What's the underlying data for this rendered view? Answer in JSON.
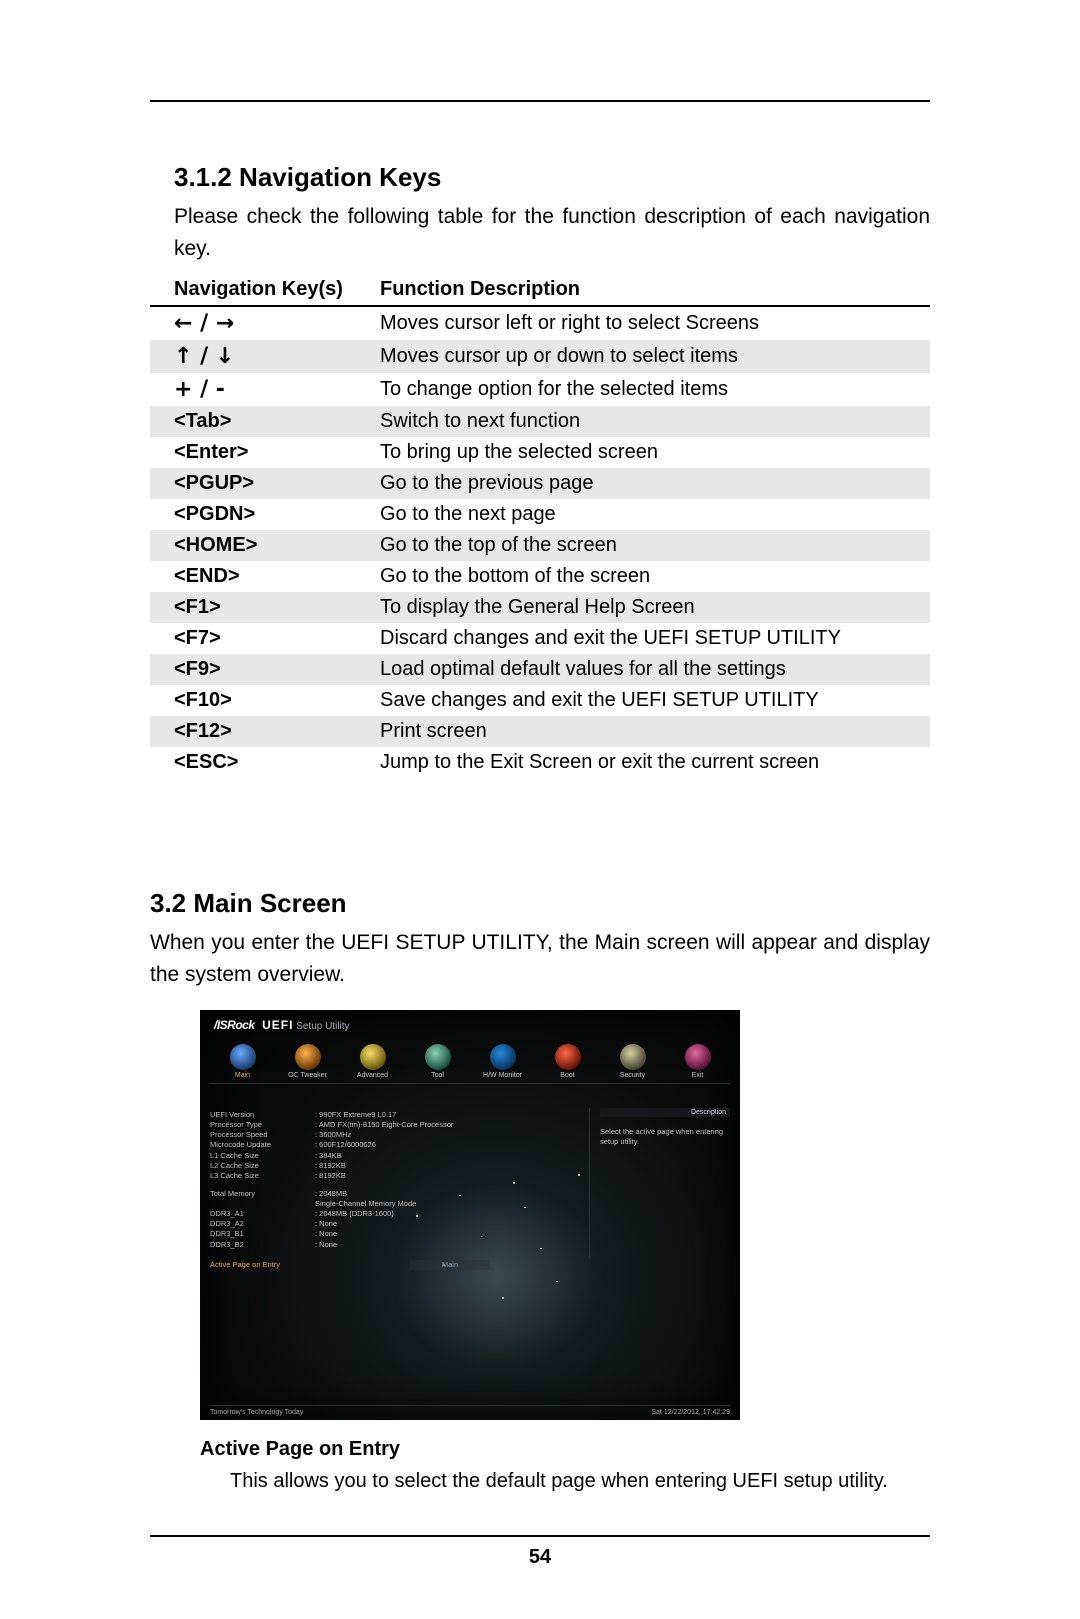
{
  "sections": {
    "nav_keys": {
      "title": "3.1.2  Navigation Keys",
      "intro": "Please check the following table for the function description of each navigation key."
    },
    "main_screen": {
      "title": "3.2  Main Screen",
      "intro": "When you enter the UEFI SETUP UTILITY, the Main screen will appear and display the system overview."
    }
  },
  "nav_table": {
    "headers": {
      "key": "Navigation Key(s)",
      "func": "Function Description"
    },
    "rows": [
      {
        "key_html": "← / →",
        "key_class": "arrow-cell",
        "func": "Moves cursor left or right to select Screens"
      },
      {
        "key_html": "↑ / ↓",
        "key_class": "arrow-cell",
        "func": "Moves cursor up or down to select items"
      },
      {
        "key_html": "+  /  -",
        "key_class": "arrow-cell",
        "func": "To change option for the selected items"
      },
      {
        "key_html": "<Tab>",
        "key_class": "",
        "func": "Switch to next function"
      },
      {
        "key_html": "<Enter>",
        "key_class": "",
        "func": "To bring up the selected screen"
      },
      {
        "key_html": "<PGUP>",
        "key_class": "",
        "func": "Go to the previous page"
      },
      {
        "key_html": "<PGDN>",
        "key_class": "",
        "func": "Go to the next page"
      },
      {
        "key_html": "<HOME>",
        "key_class": "",
        "func": "Go to the top of the screen"
      },
      {
        "key_html": "<END>",
        "key_class": "",
        "func": "Go to the bottom of the screen"
      },
      {
        "key_html": "<F1>",
        "key_class": "",
        "func": "To display the General Help Screen"
      },
      {
        "key_html": "<F7>",
        "key_class": "",
        "func": "Discard changes and exit the UEFI SETUP UTILITY"
      },
      {
        "key_html": "<F9>",
        "key_class": "",
        "func": "Load optimal default values for all the settings"
      },
      {
        "key_html": "<F10>",
        "key_class": "",
        "func": "Save changes and exit the UEFI SETUP UTILITY"
      },
      {
        "key_html": "<F12>",
        "key_class": "",
        "func": "Print screen"
      },
      {
        "key_html": "<ESC>",
        "key_class": "",
        "func": "Jump to the Exit Screen or exit the current screen"
      }
    ]
  },
  "bios": {
    "brand_styled": "/ISRock",
    "title_uefi": "UEFI",
    "title_setup": "Setup Utility",
    "tabs": [
      {
        "label": "Main",
        "icon": "ti-main",
        "active": true
      },
      {
        "label": "OC Tweaker",
        "icon": "ti-oc"
      },
      {
        "label": "Advanced",
        "icon": "ti-adv"
      },
      {
        "label": "Tool",
        "icon": "ti-tool"
      },
      {
        "label": "H/W Monitor",
        "icon": "ti-hw"
      },
      {
        "label": "Boot",
        "icon": "ti-boot"
      },
      {
        "label": "Security",
        "icon": "ti-sec"
      },
      {
        "label": "Exit",
        "icon": "ti-exit"
      }
    ],
    "info_groups": [
      [
        {
          "k": "UEFI Version",
          "v": "990FX Extreme9 L0.17"
        },
        {
          "k": "Processor Type",
          "v": "AMD FX(tm)-8150 Eight-Core Processor"
        },
        {
          "k": "Processor Speed",
          "v": "3600MHz"
        },
        {
          "k": "Microcode Update",
          "v": "600F12/6000626"
        },
        {
          "k": "L1 Cache Size",
          "v": "384KB"
        },
        {
          "k": "L2 Cache Size",
          "v": "8192KB"
        },
        {
          "k": "L3 Cache Size",
          "v": "8192KB"
        }
      ],
      [
        {
          "k": "Total Memory",
          "v": "2048MB"
        },
        {
          "indent": "Single-Channel Memory Mode"
        },
        {
          "k": "DDR3_A1",
          "v": "2048MB (DDR3-1600)"
        },
        {
          "k": "DDR3_A2",
          "v": "None"
        },
        {
          "k": "DDR3_B1",
          "v": "None"
        },
        {
          "k": "DDR3_B2",
          "v": "None"
        }
      ]
    ],
    "current_item": {
      "label": "Active Page on Entry",
      "value": "Main"
    },
    "side": {
      "header": "Description",
      "body": "Select the active page when entering setup utility."
    },
    "footer_left": "Tomorrow's Technology Today",
    "footer_right": "Sat 12/22/2012, 17:42:29"
  },
  "option": {
    "heading": "Active Page on Entry",
    "text": "This allows you to select the default page when entering UEFI setup utility."
  },
  "page_number": "54"
}
